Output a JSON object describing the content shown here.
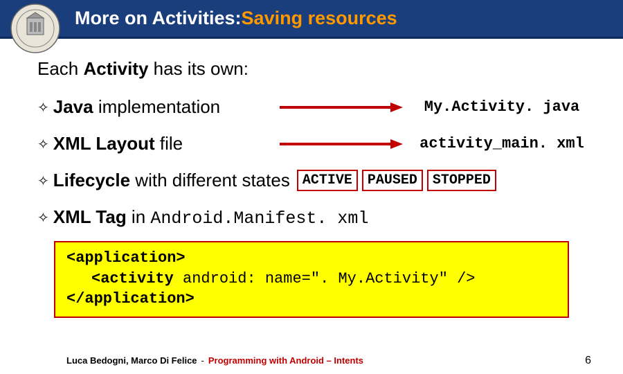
{
  "header": {
    "title_white": "More on Activities: ",
    "title_orange": "Saving resources"
  },
  "lead": {
    "prefix": "Each ",
    "bold": "Activity",
    "suffix": " has its own:"
  },
  "items": [
    {
      "label_bold": "Java",
      "label_rest": " implementation",
      "rhs": "My.Activity. java"
    },
    {
      "label_bold": "XML Layout",
      "label_rest": " file",
      "rhs": "activity_main. xml"
    }
  ],
  "lifecycle": {
    "bold": "Lifecycle",
    "rest": " with different states",
    "states": [
      "ACTIVE",
      "PAUSED",
      "STOPPED"
    ]
  },
  "xmltag": {
    "bold": "XML Tag",
    "rest_a": " in ",
    "mono": "Android.Manifest. xml"
  },
  "code": {
    "l1": "<application>",
    "l2_a": "<activity ",
    "l2_b": "android: name=\". My.Activity\" />",
    "l3": "</application>"
  },
  "footer": {
    "authors": "Luca Bedogni, Marco Di Felice",
    "dash": " - ",
    "course": "Programming with Android – Intents",
    "page": "6"
  },
  "colors": {
    "header_bg": "#1a3d7c",
    "accent_orange": "#ff9900",
    "box_border": "#c00000",
    "code_bg": "#ffff00"
  }
}
